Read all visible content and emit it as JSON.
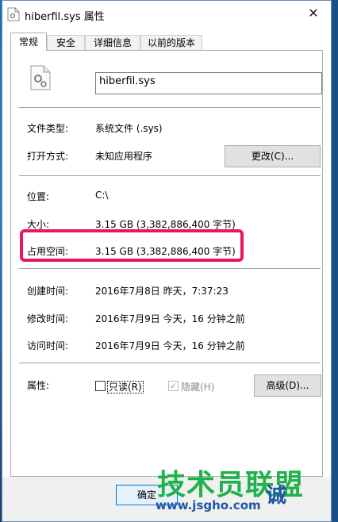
{
  "window": {
    "title": "hiberfil.sys 属性",
    "close_symbol": "✕"
  },
  "tabs": [
    "常规",
    "安全",
    "详细信息",
    "以前的版本"
  ],
  "file_name": "hiberfil.sys",
  "rows": {
    "type_label": "文件类型:",
    "type_value": "系统文件 (.sys)",
    "open_label": "打开方式:",
    "open_value": "未知应用程序",
    "change_button": "更改(C)...",
    "location_label": "位置:",
    "location_value": "C:\\",
    "size_label": "大小:",
    "size_value": "3.15 GB (3,382,886,400 字节)",
    "disk_label": "占用空间:",
    "disk_value": "3.15 GB (3,382,886,400 字节)",
    "created_label": "创建时间:",
    "created_value": "2016年7月8日 昨天，7:37:23",
    "modified_label": "修改时间:",
    "modified_value": "2016年7月9日 今天，16 分钟之前",
    "accessed_label": "访问时间:",
    "accessed_value": "2016年7月9日 今天，16 分钟之前"
  },
  "attributes": {
    "label": "属性:",
    "readonly": "只读(R)",
    "readonly_checked": false,
    "hidden": "隐藏(H)",
    "hidden_checked": true,
    "advanced_button": "高级(D)...",
    "check_mark": "✓"
  },
  "footer": {
    "ok_button": "确定"
  },
  "watermark": {
    "main": "技术员联盟",
    "url": "www.jsgho.com",
    "extra": "诚"
  },
  "colors": {
    "highlight": "#e8175d",
    "watermark_green": "#20b24a",
    "watermark_blue": "#1f56a8"
  }
}
